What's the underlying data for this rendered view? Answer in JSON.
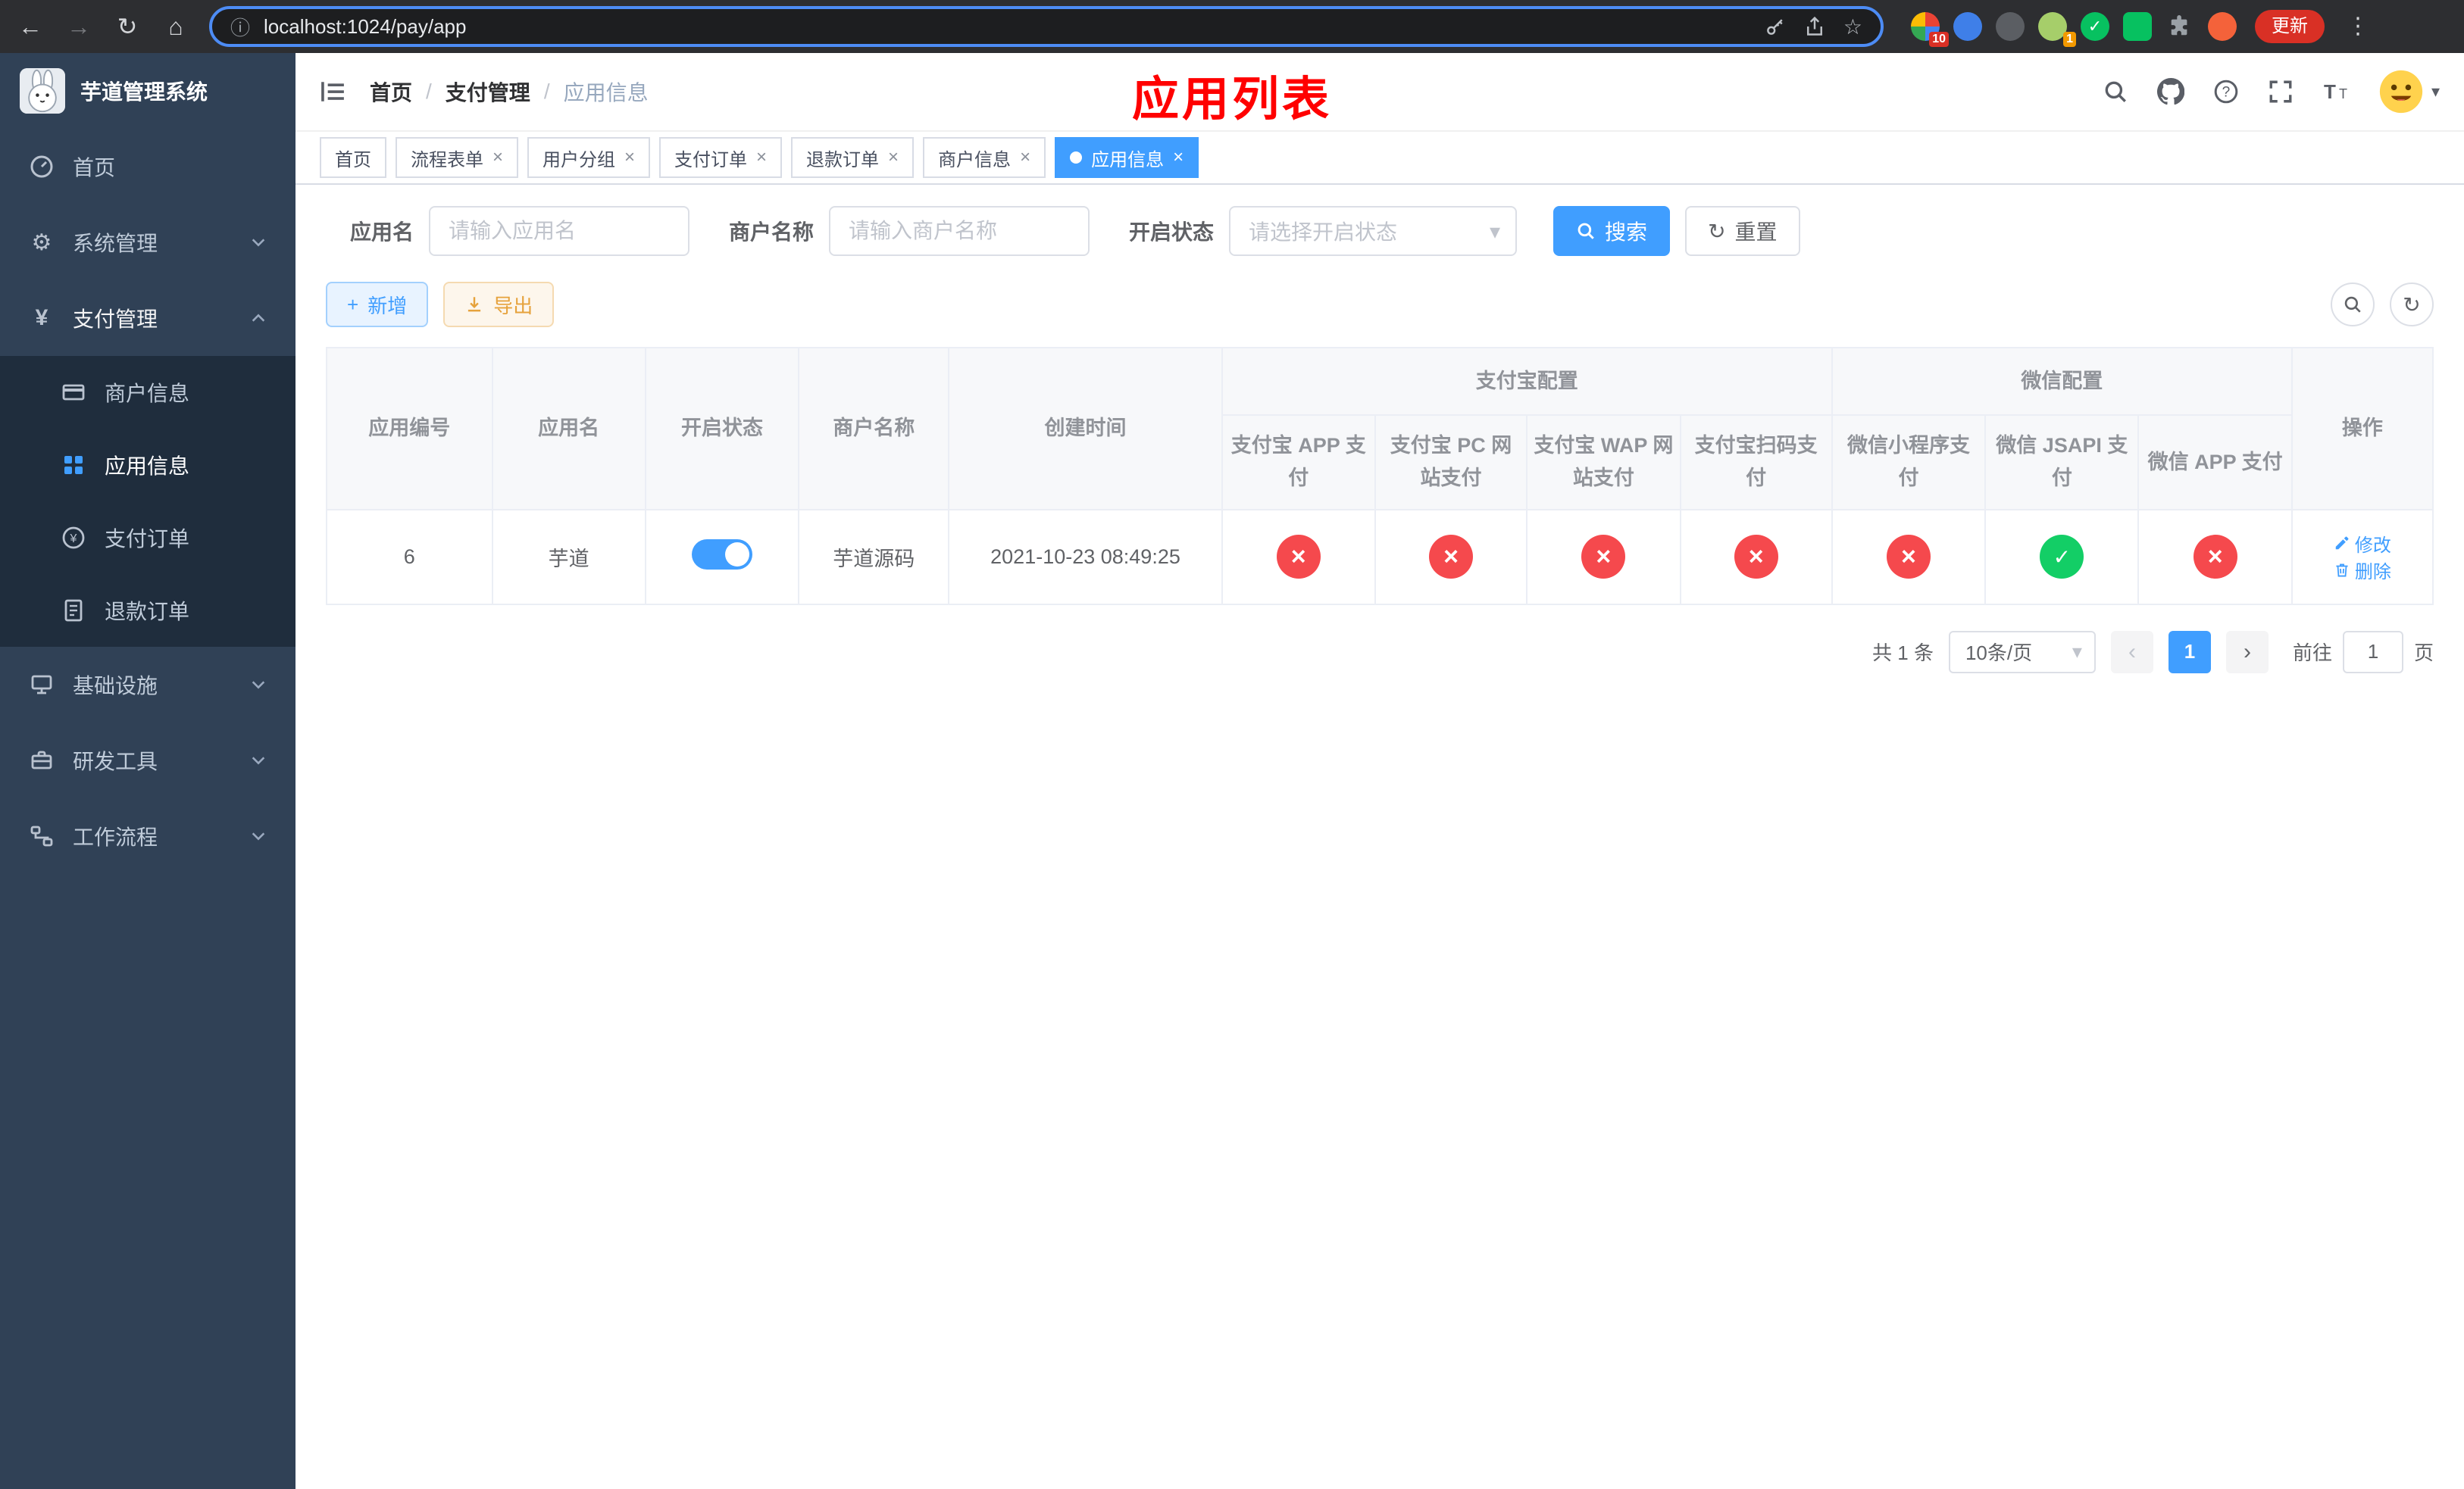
{
  "browser": {
    "url": "localhost:1024/pay/app",
    "update_label": "更新",
    "ext_badges": {
      "first": "10",
      "fourth": "1"
    }
  },
  "sidebar": {
    "title": "芋道管理系统",
    "menu": [
      {
        "label": "首页"
      },
      {
        "label": "系统管理"
      },
      {
        "label": "支付管理"
      },
      {
        "label": "基础设施"
      },
      {
        "label": "研发工具"
      },
      {
        "label": "工作流程"
      }
    ],
    "payment_children": [
      {
        "label": "商户信息"
      },
      {
        "label": "应用信息"
      },
      {
        "label": "支付订单"
      },
      {
        "label": "退款订单"
      }
    ]
  },
  "header": {
    "breadcrumb": [
      "首页",
      "支付管理",
      "应用信息"
    ],
    "annotation": "应用列表"
  },
  "tabs": [
    {
      "label": "首页"
    },
    {
      "label": "流程表单"
    },
    {
      "label": "用户分组"
    },
    {
      "label": "支付订单"
    },
    {
      "label": "退款订单"
    },
    {
      "label": "商户信息"
    },
    {
      "label": "应用信息"
    }
  ],
  "filters": {
    "app_name_label": "应用名",
    "app_name_placeholder": "请输入应用名",
    "merchant_label": "商户名称",
    "merchant_placeholder": "请输入商户名称",
    "status_label": "开启状态",
    "status_placeholder": "请选择开启状态",
    "search_label": "搜索",
    "reset_label": "重置"
  },
  "toolbar": {
    "add_label": "新增",
    "export_label": "导出"
  },
  "table": {
    "col_id": "应用编号",
    "col_name": "应用名",
    "col_status": "开启状态",
    "col_merchant": "商户名称",
    "col_created": "创建时间",
    "alipay_group": "支付宝配置",
    "alipay_cols": [
      "支付宝 APP 支付",
      "支付宝 PC 网站支付",
      "支付宝 WAP 网站支付",
      "支付宝扫码支付"
    ],
    "wechat_group": "微信配置",
    "wechat_cols": [
      "微信小程序支付",
      "微信 JSAPI 支付",
      "微信 APP 支付"
    ],
    "col_op": "操作",
    "row": {
      "id": "6",
      "name": "芋道",
      "enabled": "on",
      "merchant": "芋道源码",
      "created": "2021-10-23 08:49:25",
      "alipay_app": "x",
      "alipay_pc": "x",
      "alipay_wap": "x",
      "alipay_qr": "x",
      "wechat_mini": "x",
      "wechat_jsapi": "check",
      "wechat_app": "x",
      "edit_label": "修改",
      "delete_label": "删除"
    }
  },
  "pagination": {
    "total_text": "共 1 条",
    "page_size": "10条/页",
    "page": "1",
    "goto_label": "前往",
    "goto_value": "1",
    "page_unit": "页"
  },
  "colors": {
    "accent": "#409eff",
    "danger": "#f5494d",
    "success": "#13ce66",
    "annotation_red": "#ff0000",
    "sidebar_bg": "#304156",
    "submenu_bg": "#1f2d3d"
  }
}
